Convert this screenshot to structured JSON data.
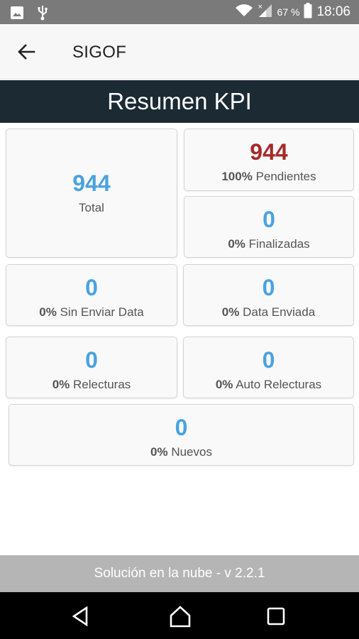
{
  "status_bar": {
    "battery_percent": "67 %",
    "time": "18:06",
    "icons": [
      "image-icon",
      "usb-icon",
      "wifi-icon",
      "signal-icon",
      "battery-icon"
    ]
  },
  "app_bar": {
    "title": "SIGOF",
    "back_icon": "arrow-left-icon"
  },
  "header": {
    "title": "Resumen KPI"
  },
  "cards": {
    "total": {
      "value": "944",
      "label": "Total"
    },
    "pendientes": {
      "value": "944",
      "percent": "100%",
      "label": "Pendientes"
    },
    "finalizadas": {
      "value": "0",
      "percent": "0%",
      "label": "Finalizadas"
    },
    "sin_enviar": {
      "value": "0",
      "percent": "0%",
      "label": "Sin Enviar Data"
    },
    "data_enviada": {
      "value": "0",
      "percent": "0%",
      "label": "Data Enviada"
    },
    "relecturas": {
      "value": "0",
      "percent": "0%",
      "label": "Relecturas"
    },
    "auto_relecturas": {
      "value": "0",
      "percent": "0%",
      "label": "Auto Relecturas"
    },
    "nuevos": {
      "value": "0",
      "percent": "0%",
      "label": "Nuevos"
    }
  },
  "colors": {
    "value_blue": "#4aa3df",
    "value_red": "#a52a2a",
    "header_bg": "#1b2a33",
    "status_bar_bg": "#7a7a7a",
    "footer_bg": "#b5b5b5"
  },
  "footer": {
    "text": "Solución en la nube - v 2.2.1"
  },
  "nav_bar": {
    "icons": [
      "back-triangle-icon",
      "home-icon",
      "recents-icon"
    ]
  }
}
